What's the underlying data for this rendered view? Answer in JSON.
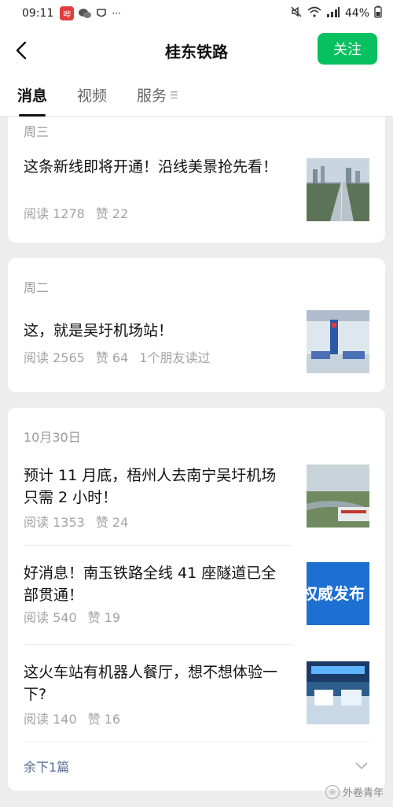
{
  "status_bar": {
    "time": "09:11",
    "app_badge": "哔",
    "battery": "44%",
    "network": "4G"
  },
  "header": {
    "title": "桂东铁路",
    "follow_label": "关注"
  },
  "tabs": [
    {
      "label": "消息",
      "active": true
    },
    {
      "label": "视频",
      "active": false
    },
    {
      "label": "服务",
      "active": false
    }
  ],
  "groups": [
    {
      "date": "周三",
      "articles": [
        {
          "title": "这条新线即将开通！沿线美景抢先看！",
          "reads": "阅读 1278",
          "likes": "赞 22",
          "extra": ""
        }
      ]
    },
    {
      "date": "周二",
      "articles": [
        {
          "title": "这，就是吴圩机场站！",
          "reads": "阅读 2565",
          "likes": "赞 64",
          "extra": "1个朋友读过"
        }
      ]
    },
    {
      "date": "10月30日",
      "articles": [
        {
          "title": "预计 11 月底，梧州人去南宁吴圩机场只需 2 小时！",
          "reads": "阅读 1353",
          "likes": "赞 24",
          "extra": ""
        },
        {
          "title": "好消息！南玉铁路全线 41 座隧道已全部贯通！",
          "reads": "阅读 540",
          "likes": "赞 19",
          "extra": "",
          "thumb_text": "权威发布"
        },
        {
          "title": "这火车站有机器人餐厅，想不想体验一下?",
          "reads": "阅读 140",
          "likes": "赞 16",
          "extra": ""
        }
      ],
      "more_label": "余下1篇"
    }
  ],
  "watermark": "外卷青年",
  "colors": {
    "accent_green": "#07c160",
    "link_blue": "#576b95",
    "background": "#ededed"
  }
}
